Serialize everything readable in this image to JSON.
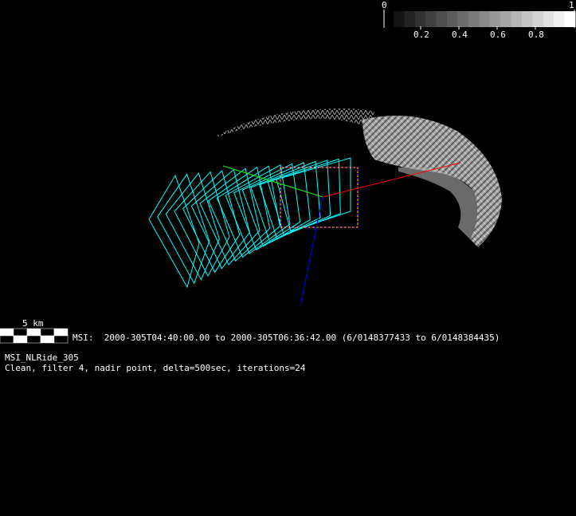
{
  "colorbar": {
    "min_label": "0",
    "max_label": "1",
    "tick_labels": [
      "0.2",
      "0.4",
      "0.6",
      "0.8"
    ],
    "steps": 17
  },
  "scale_bar": {
    "label": "5 km"
  },
  "info": {
    "time_range": "MSI:  2000-305T04:40:00.00 to 2000-305T06:36:42.00 (6/0148377433 to 6/0148384435)",
    "name": "MSI_NLRide_305",
    "description": "Clean, filter 4, nadir point, delta=500sec, iterations=24"
  },
  "colors": {
    "footprints": "#00ffff",
    "current_frame": "#ff00ff",
    "x_axis": "#ff0000",
    "y_axis": "#00ff00",
    "z_axis": "#0000ff"
  }
}
